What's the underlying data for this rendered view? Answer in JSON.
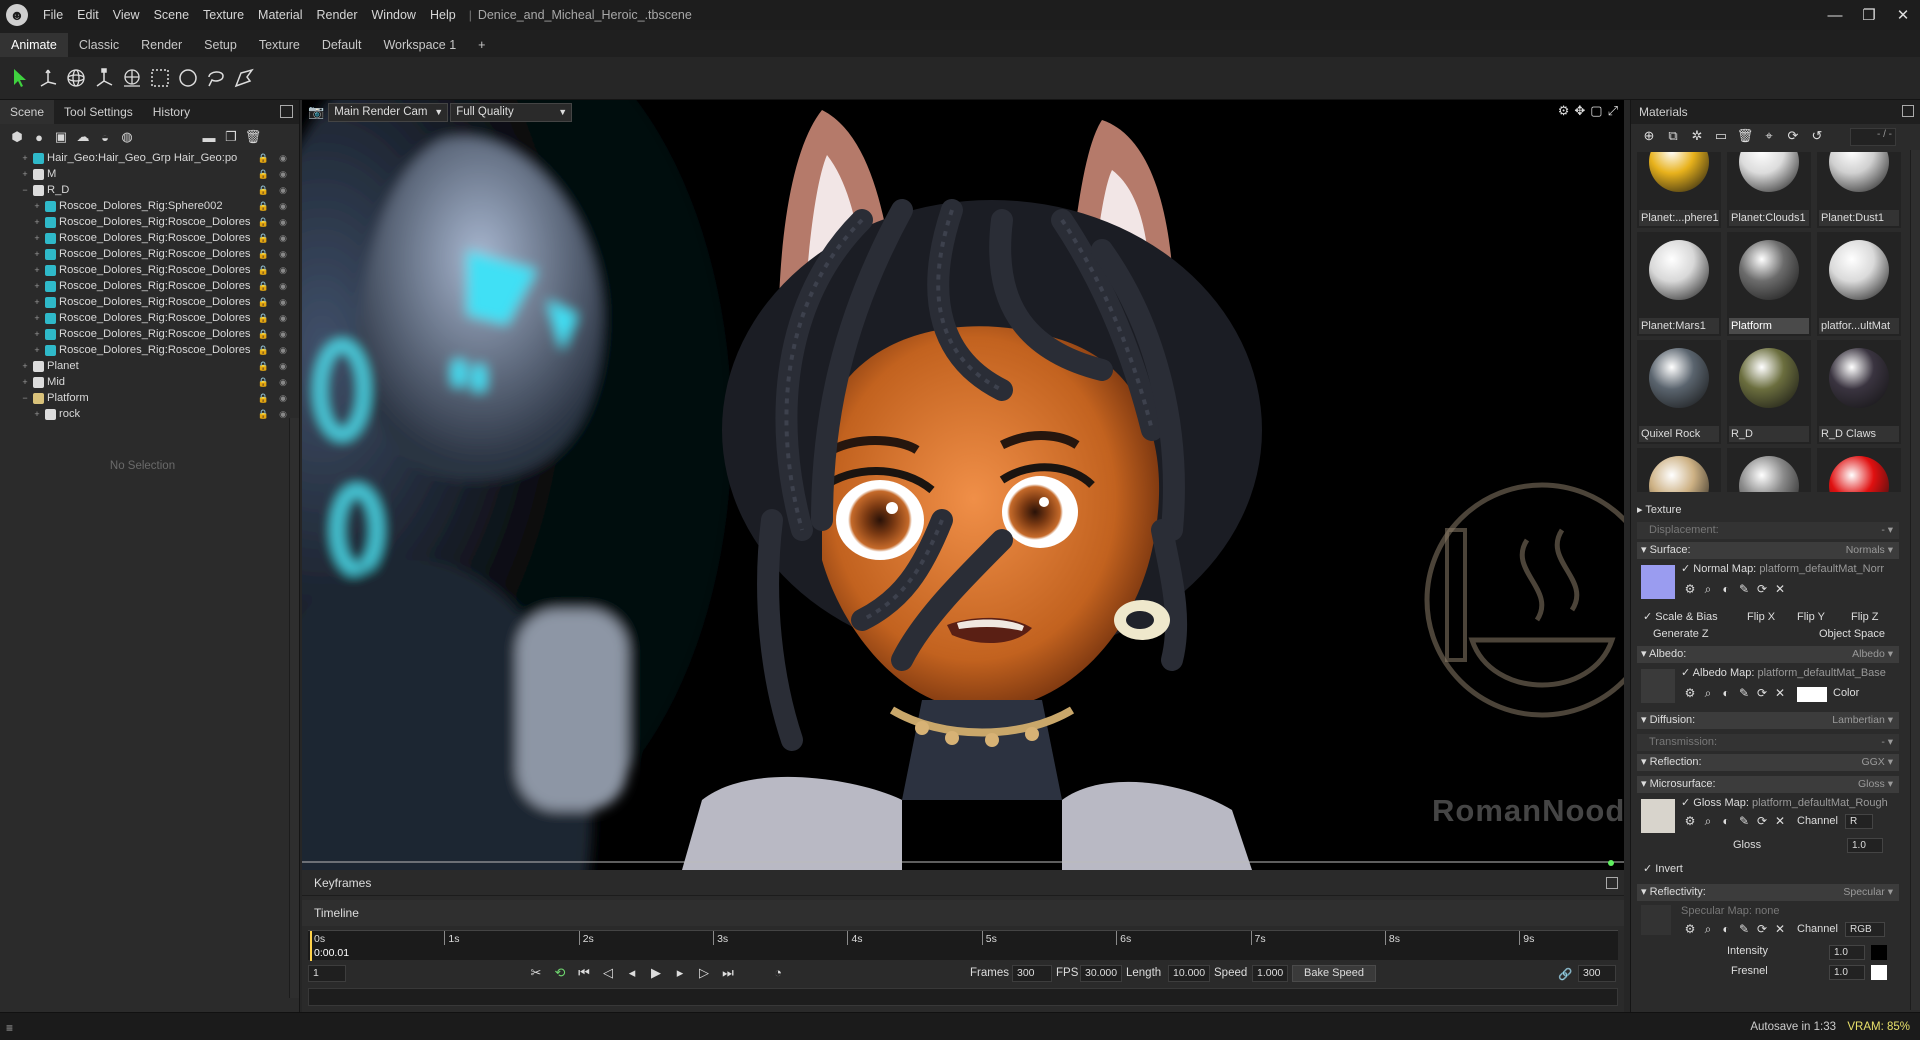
{
  "window": {
    "title": "Denice_and_Micheal_Heroic_.tbscene",
    "menu": [
      "File",
      "Edit",
      "View",
      "Scene",
      "Texture",
      "Material",
      "Render",
      "Window",
      "Help"
    ],
    "controls": {
      "minimize": "—",
      "maximize": "❐",
      "close": "✕"
    }
  },
  "workspace_tabs": [
    "Animate",
    "Classic",
    "Render",
    "Setup",
    "Texture",
    "Default",
    "Workspace 1",
    "+"
  ],
  "toolbar": {
    "tools": [
      "select-arrow-icon",
      "move-icon",
      "rotate-icon",
      "scale-icon",
      "widget-icon",
      "rect-select-icon",
      "circle-select-icon",
      "lasso-select-icon",
      "paint-select-icon"
    ]
  },
  "left_panel": {
    "tabs": [
      "Scene",
      "Tool Settings",
      "History"
    ],
    "tree": [
      {
        "depth": 1,
        "expander": "+",
        "icon": "mesh",
        "label": "Hair_Geo:Hair_Geo_Grp Hair_Geo:po"
      },
      {
        "depth": 1,
        "expander": "+",
        "icon": "group",
        "label": "M"
      },
      {
        "depth": 1,
        "expander": "−",
        "icon": "group",
        "label": "R_D"
      },
      {
        "depth": 2,
        "expander": "+",
        "icon": "mesh",
        "label": "Roscoe_Dolores_Rig:Sphere002"
      },
      {
        "depth": 2,
        "expander": "+",
        "icon": "mesh",
        "label": "Roscoe_Dolores_Rig:Roscoe_Dolores"
      },
      {
        "depth": 2,
        "expander": "+",
        "icon": "mesh",
        "label": "Roscoe_Dolores_Rig:Roscoe_Dolores"
      },
      {
        "depth": 2,
        "expander": "+",
        "icon": "mesh",
        "label": "Roscoe_Dolores_Rig:Roscoe_Dolores"
      },
      {
        "depth": 2,
        "expander": "+",
        "icon": "mesh",
        "label": "Roscoe_Dolores_Rig:Roscoe_Dolores"
      },
      {
        "depth": 2,
        "expander": "+",
        "icon": "mesh",
        "label": "Roscoe_Dolores_Rig:Roscoe_Dolores"
      },
      {
        "depth": 2,
        "expander": "+",
        "icon": "mesh",
        "label": "Roscoe_Dolores_Rig:Roscoe_Dolores"
      },
      {
        "depth": 2,
        "expander": "+",
        "icon": "mesh",
        "label": "Roscoe_Dolores_Rig:Roscoe_Dolores"
      },
      {
        "depth": 2,
        "expander": "+",
        "icon": "mesh",
        "label": "Roscoe_Dolores_Rig:Roscoe_Dolores"
      },
      {
        "depth": 2,
        "expander": "+",
        "icon": "mesh",
        "label": "Roscoe_Dolores_Rig:Roscoe_Dolores"
      },
      {
        "depth": 1,
        "expander": "+",
        "icon": "group",
        "label": "Planet"
      },
      {
        "depth": 1,
        "expander": "+",
        "icon": "group",
        "label": "Mid"
      },
      {
        "depth": 1,
        "expander": "−",
        "icon": "folder",
        "label": "Platform"
      },
      {
        "depth": 2,
        "expander": "+",
        "icon": "group",
        "label": "rock"
      }
    ],
    "no_selection": "No Selection"
  },
  "viewport": {
    "camera": "Main Render Cam",
    "quality": "Full Quality",
    "watermark": "RomanNoodles"
  },
  "materials": {
    "title": "Materials",
    "filter": "- / -",
    "items": [
      {
        "name": "Planet:...phere1",
        "color": "#e8b21c"
      },
      {
        "name": "Planet:Clouds1",
        "color": "#dcdcdc"
      },
      {
        "name": "Planet:Dust1",
        "color": "#d0d0d0"
      },
      {
        "name": "Planet:Mars1",
        "color": "#d8d8d8"
      },
      {
        "name": "Platform",
        "color": "#6c6c6c",
        "selected": true
      },
      {
        "name": "platfor...ultMat",
        "color": "#dadada"
      },
      {
        "name": "Quixel Rock",
        "color": "#5a646e"
      },
      {
        "name": "R_D",
        "color": "#6b6e3e"
      },
      {
        "name": "R_D Claws",
        "color": "#3a3440"
      },
      {
        "name": "",
        "color": "#cdb184"
      },
      {
        "name": "",
        "color": "#8a8a8a"
      },
      {
        "name": "",
        "color": "#e01010"
      }
    ],
    "props": {
      "texture": "Texture",
      "displacement": {
        "label": "Displacement:",
        "value": "- ▾"
      },
      "surface": {
        "label": "Surface:",
        "value": "Normals ▾"
      },
      "normal_map": {
        "label": "Normal Map:",
        "value": "platform_defaultMat_Norr"
      },
      "scale_bias": "Scale & Bias",
      "flip_x": "Flip X",
      "flip_y": "Flip Y",
      "flip_z": "Flip Z",
      "generate_z": "Generate Z",
      "object_space": "Object Space",
      "albedo": {
        "label": "Albedo:",
        "value": "Albedo ▾"
      },
      "albedo_map": {
        "label": "Albedo Map:",
        "value": "platform_defaultMat_Base"
      },
      "color_label": "Color",
      "diffusion": {
        "label": "Diffusion:",
        "value": "Lambertian ▾"
      },
      "transmission": {
        "label": "Transmission:",
        "value": "- ▾"
      },
      "reflection": {
        "label": "Reflection:",
        "value": "GGX ▾"
      },
      "microsurface": {
        "label": "Microsurface:",
        "value": "Gloss ▾"
      },
      "gloss_map": {
        "label": "Gloss Map:",
        "value": "platform_defaultMat_Rough"
      },
      "channel_label": "Channel",
      "gloss_channel": "R",
      "gloss_label": "Gloss",
      "gloss_value": "1.0",
      "invert": "Invert",
      "reflectivity": {
        "label": "Reflectivity:",
        "value": "Specular ▾"
      },
      "specular_map": "Specular Map: none",
      "spec_channel": "RGB",
      "intensity_label": "Intensity",
      "intensity_value": "1.0",
      "fresnel_label": "Fresnel",
      "fresnel_value": "1.0"
    }
  },
  "timeline": {
    "keyframes_tab": "Keyframes",
    "timeline_tab": "Timeline",
    "time_readout": "0:00.01",
    "ticks": [
      "0s",
      "1s",
      "2s",
      "3s",
      "4s",
      "5s",
      "6s",
      "7s",
      "8s",
      "9s"
    ],
    "frame": "1",
    "frames_label": "Frames",
    "frames_value": "300",
    "fps_label": "FPS",
    "fps_value": "30.000",
    "length_label": "Length",
    "length_value": "10.000",
    "speed_label": "Speed",
    "speed_value": "1.000",
    "bake_speed": "Bake Speed",
    "end_frame": "300"
  },
  "status": {
    "autosave": "Autosave in 1:33",
    "vram": "VRAM: 85%"
  }
}
